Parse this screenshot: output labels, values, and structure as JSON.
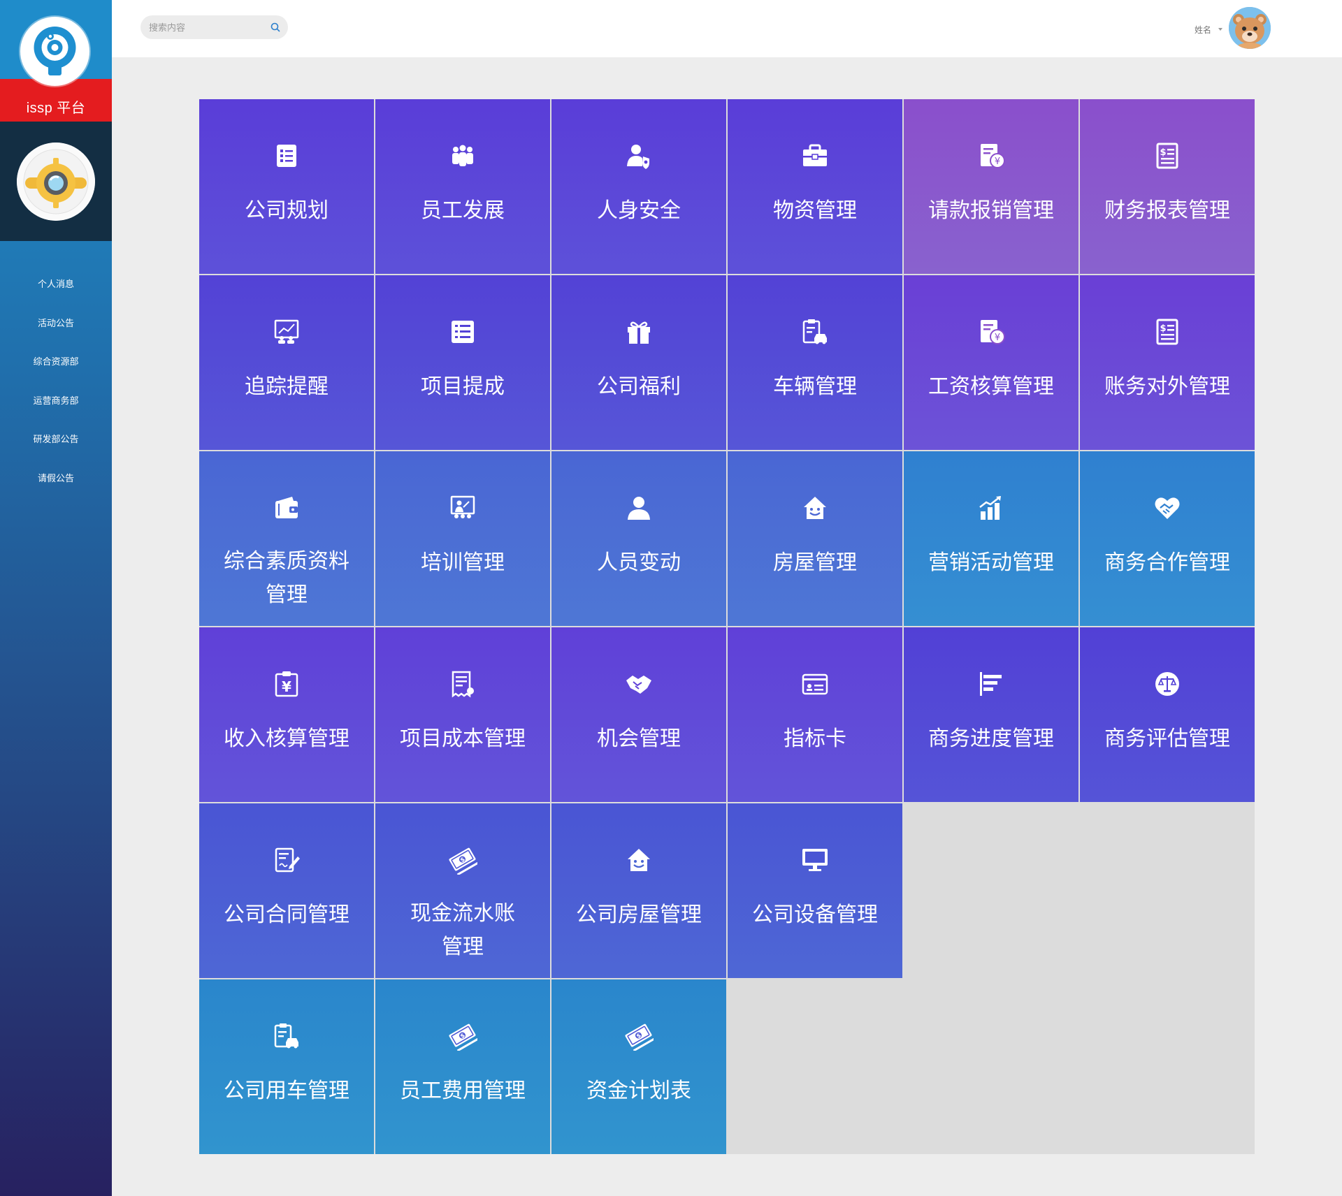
{
  "app": {
    "logo_text": "issp 平台",
    "colors": {
      "brand_red": "#e41c1f",
      "sidebar_top": "#1f8fc9",
      "sidebar_bottom": "#272160"
    }
  },
  "sidebar": {
    "items": [
      {
        "label": "个人消息"
      },
      {
        "label": "活动公告"
      },
      {
        "label": "综合资源部"
      },
      {
        "label": "运营商务部"
      },
      {
        "label": "研发部公告"
      },
      {
        "label": "请假公告"
      }
    ]
  },
  "header": {
    "search": {
      "placeholder": "搜索内容",
      "icon": "search-icon"
    },
    "user": {
      "name": "姓名",
      "icon": "caret-down-icon"
    }
  },
  "tiles": [
    {
      "label": "公司规划",
      "icon": "file-list-icon",
      "color": "#5a3dd8"
    },
    {
      "label": "员工发展",
      "icon": "team-icon",
      "color": "#5a3dd8"
    },
    {
      "label": "人身安全",
      "icon": "user-shield-icon",
      "color": "#5a3dd8"
    },
    {
      "label": "物资管理",
      "icon": "toolbox-icon",
      "color": "#5a3dd8"
    },
    {
      "label": "请款报销管理",
      "icon": "yen-document-icon",
      "color": "#8a4fcc"
    },
    {
      "label": "财务报表管理",
      "icon": "dollar-document-icon",
      "color": "#8a4fcc"
    },
    {
      "label": "追踪提醒",
      "icon": "chart-board-icon",
      "color": "#5342d6"
    },
    {
      "label": "项目提成",
      "icon": "list-icon",
      "color": "#5342d6"
    },
    {
      "label": "公司福利",
      "icon": "gift-icon",
      "color": "#5342d6"
    },
    {
      "label": "车辆管理",
      "icon": "car-clipboard-icon",
      "color": "#5342d6"
    },
    {
      "label": "工资核算管理",
      "icon": "yen-document-icon",
      "color": "#6a3fd6"
    },
    {
      "label": "账务对外管理",
      "icon": "dollar-document-icon",
      "color": "#6a3fd6"
    },
    {
      "label": "综合素质资料管理",
      "icon": "wallet-icon",
      "color": "#4a66d4"
    },
    {
      "label": "培训管理",
      "icon": "presentation-icon",
      "color": "#4a66d4"
    },
    {
      "label": "人员变动",
      "icon": "user-icon",
      "color": "#4a66d4"
    },
    {
      "label": "房屋管理",
      "icon": "smile-house-icon",
      "color": "#4a66d4"
    },
    {
      "label": "营销活动管理",
      "icon": "growth-chart-icon",
      "color": "#2f80d0"
    },
    {
      "label": "商务合作管理",
      "icon": "heart-handshake-icon",
      "color": "#2f80d0"
    },
    {
      "label": "收入核算管理",
      "icon": "yen-clipboard-icon",
      "color": "#6040d8"
    },
    {
      "label": "项目成本管理",
      "icon": "receipt-icon",
      "color": "#6040d8"
    },
    {
      "label": "机会管理",
      "icon": "handshake-icon",
      "color": "#6040d8"
    },
    {
      "label": "指标卡",
      "icon": "id-card-icon",
      "color": "#6040d8"
    },
    {
      "label": "商务进度管理",
      "icon": "bar-progress-icon",
      "color": "#5240d6"
    },
    {
      "label": "商务评估管理",
      "icon": "balance-scale-icon",
      "color": "#5240d6"
    },
    {
      "label": "公司合同管理",
      "icon": "contract-icon",
      "color": "#4a55d4"
    },
    {
      "label": "现金流水账管理",
      "icon": "cash-icon",
      "color": "#4a55d4"
    },
    {
      "label": "公司房屋管理",
      "icon": "smile-house-icon",
      "color": "#4a55d4"
    },
    {
      "label": "公司设备管理",
      "icon": "monitor-icon",
      "color": "#4a55d4"
    },
    {
      "label": "公司用车管理",
      "icon": "car-clipboard-icon",
      "color": "#2a86cc"
    },
    {
      "label": "员工费用管理",
      "icon": "cash-icon",
      "color": "#2a86cc"
    },
    {
      "label": "资金计划表",
      "icon": "cash-icon",
      "color": "#2a86cc"
    }
  ]
}
